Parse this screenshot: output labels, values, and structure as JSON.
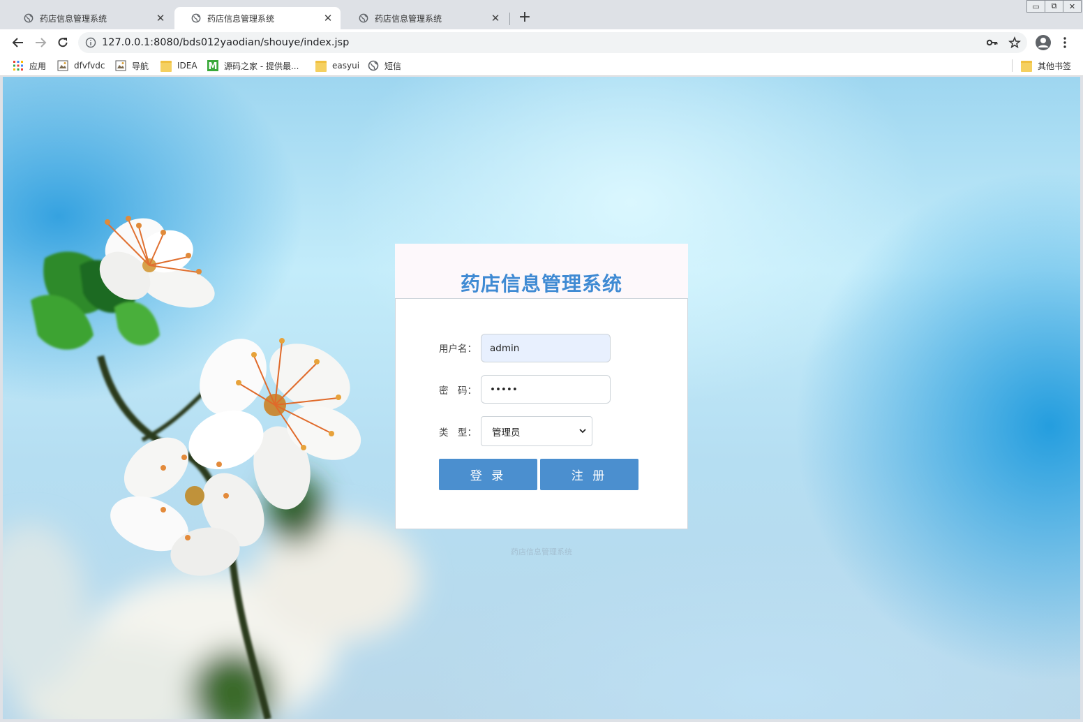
{
  "tabs": [
    {
      "title": "药店信息管理系统",
      "active": false
    },
    {
      "title": "药店信息管理系统",
      "active": true
    },
    {
      "title": "药店信息管理系统",
      "active": false
    }
  ],
  "address_bar": {
    "url": "127.0.0.1:8080/bds012yaodian/shouye/index.jsp"
  },
  "bookmarks": {
    "items": [
      {
        "label": "应用",
        "icon": "apps-grid-icon"
      },
      {
        "label": "dfvfvdc",
        "icon": "page-image-icon"
      },
      {
        "label": "导航",
        "icon": "page-image-icon"
      },
      {
        "label": "IDEA",
        "icon": "folder-icon"
      },
      {
        "label": "源码之家 - 提供最...",
        "icon": "m-logo-icon"
      },
      {
        "label": "easyui",
        "icon": "folder-icon"
      },
      {
        "label": "短信",
        "icon": "globe-icon"
      }
    ],
    "other": "其他书签"
  },
  "login": {
    "title": "药店信息管理系统",
    "username_label": "用户名：",
    "username_value": "admin",
    "password_label": "密　码：",
    "password_value": "•••••",
    "type_label": "类　型：",
    "type_selected": "管理员",
    "login_button": "登 录",
    "register_button": "注 册",
    "footer": "药店信息管理系统"
  },
  "colors": {
    "accent": "#4b8fcf",
    "title": "#3f8ad3"
  }
}
